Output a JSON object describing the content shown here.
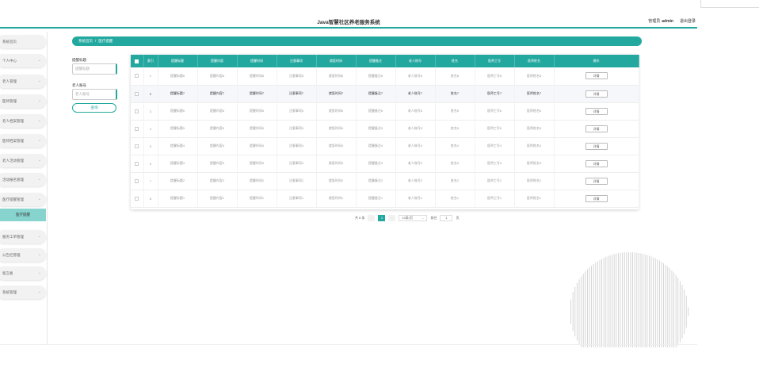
{
  "header": {
    "title": "Java智慧社区养老服务系统",
    "user_role": "管理员",
    "user_name": "admin",
    "logout": "退出登录"
  },
  "sidebar": {
    "items": [
      {
        "label": "系统首页",
        "has_children": false
      },
      {
        "label": "个人中心",
        "has_children": true
      },
      {
        "label": "老人管理",
        "has_children": true
      },
      {
        "label": "医师管理",
        "has_children": true
      },
      {
        "label": "老人档案管理",
        "has_children": true
      },
      {
        "label": "医师档案管理",
        "has_children": true
      },
      {
        "label": "老人活动管理",
        "has_children": true
      },
      {
        "label": "活动报名管理",
        "has_children": true
      },
      {
        "label": "医疗提醒管理",
        "has_children": true
      },
      {
        "label": "服务工单管理",
        "has_children": true
      },
      {
        "label": "公告栏管理",
        "has_children": true
      },
      {
        "label": "留言板",
        "has_children": true
      },
      {
        "label": "系统管理",
        "has_children": true
      }
    ],
    "active_sub": "医疗提醒"
  },
  "breadcrumb": {
    "home": "系统首页",
    "separator": "/",
    "current": "医疗提醒"
  },
  "search": {
    "field1_label": "提醒标题",
    "field1_placeholder": "提醒标题",
    "field2_label": "老人账号",
    "field2_placeholder": "老人账号",
    "button": "查询"
  },
  "table": {
    "headers": [
      "索引",
      "提醒标题",
      "提醒内容",
      "提醒时间",
      "注意事项",
      "就医时间",
      "提醒备注",
      "老人账号",
      "姓名",
      "医师工号",
      "医师姓名",
      "操作"
    ],
    "rows": [
      {
        "idx": "1",
        "c1": "提醒标题8",
        "c2": "提醒内容8",
        "c3": "提醒时间8",
        "c4": "注意事项8",
        "c5": "就医时间8",
        "c6": "提醒备注8",
        "c7": "老人账号8",
        "c8": "姓名8",
        "c9": "医师工号8",
        "c10": "医师姓名8",
        "action": "详情"
      },
      {
        "idx": "2",
        "c1": "提醒标题7",
        "c2": "提醒内容7",
        "c3": "提醒时间7",
        "c4": "注意事项7",
        "c5": "就医时间7",
        "c6": "提醒备注7",
        "c7": "老人账号7",
        "c8": "姓名7",
        "c9": "医师工号7",
        "c10": "医师姓名7",
        "action": "详情"
      },
      {
        "idx": "3",
        "c1": "提醒标题6",
        "c2": "提醒内容6",
        "c3": "提醒时间6",
        "c4": "注意事项6",
        "c5": "就医时间6",
        "c6": "提醒备注6",
        "c7": "老人账号6",
        "c8": "姓名6",
        "c9": "医师工号6",
        "c10": "医师姓名6",
        "action": "详情"
      },
      {
        "idx": "4",
        "c1": "提醒标题5",
        "c2": "提醒内容5",
        "c3": "提醒时间5",
        "c4": "注意事项5",
        "c5": "就医时间5",
        "c6": "提醒备注5",
        "c7": "老人账号5",
        "c8": "姓名5",
        "c9": "医师工号5",
        "c10": "医师姓名5",
        "action": "详情"
      },
      {
        "idx": "5",
        "c1": "提醒标题4",
        "c2": "提醒内容4",
        "c3": "提醒时间4",
        "c4": "注意事项4",
        "c5": "就医时间4",
        "c6": "提醒备注4",
        "c7": "老人账号4",
        "c8": "姓名4",
        "c9": "医师工号4",
        "c10": "医师姓名4",
        "action": "详情"
      },
      {
        "idx": "6",
        "c1": "提醒标题3",
        "c2": "提醒内容3",
        "c3": "提醒时间3",
        "c4": "注意事项3",
        "c5": "就医时间3",
        "c6": "提醒备注3",
        "c7": "老人账号3",
        "c8": "姓名3",
        "c9": "医师工号3",
        "c10": "医师姓名3",
        "action": "详情"
      },
      {
        "idx": "7",
        "c1": "提醒标题2",
        "c2": "提醒内容2",
        "c3": "提醒时间2",
        "c4": "注意事项2",
        "c5": "就医时间2",
        "c6": "提醒备注2",
        "c7": "老人账号2",
        "c8": "姓名2",
        "c9": "医师工号2",
        "c10": "医师姓名2",
        "action": "详情"
      },
      {
        "idx": "8",
        "c1": "提醒标题1",
        "c2": "提醒内容1",
        "c3": "提醒时间1",
        "c4": "注意事项1",
        "c5": "就医时间1",
        "c6": "提醒备注1",
        "c7": "老人账号1",
        "c8": "姓名1",
        "c9": "医师工号1",
        "c10": "医师姓名1",
        "action": "详情"
      }
    ],
    "highlighted_row": 1
  },
  "pager": {
    "total": "共 8 条",
    "prev_icon": "chevron-left-icon",
    "current_page": "1",
    "next_icon": "chevron-right-icon",
    "page_size": "10条/页",
    "goto_label": "前往",
    "goto_value": "1",
    "goto_unit": "页"
  },
  "colors": {
    "accent": "#23a8a0",
    "active_sub_bg": "#87d3ce"
  }
}
